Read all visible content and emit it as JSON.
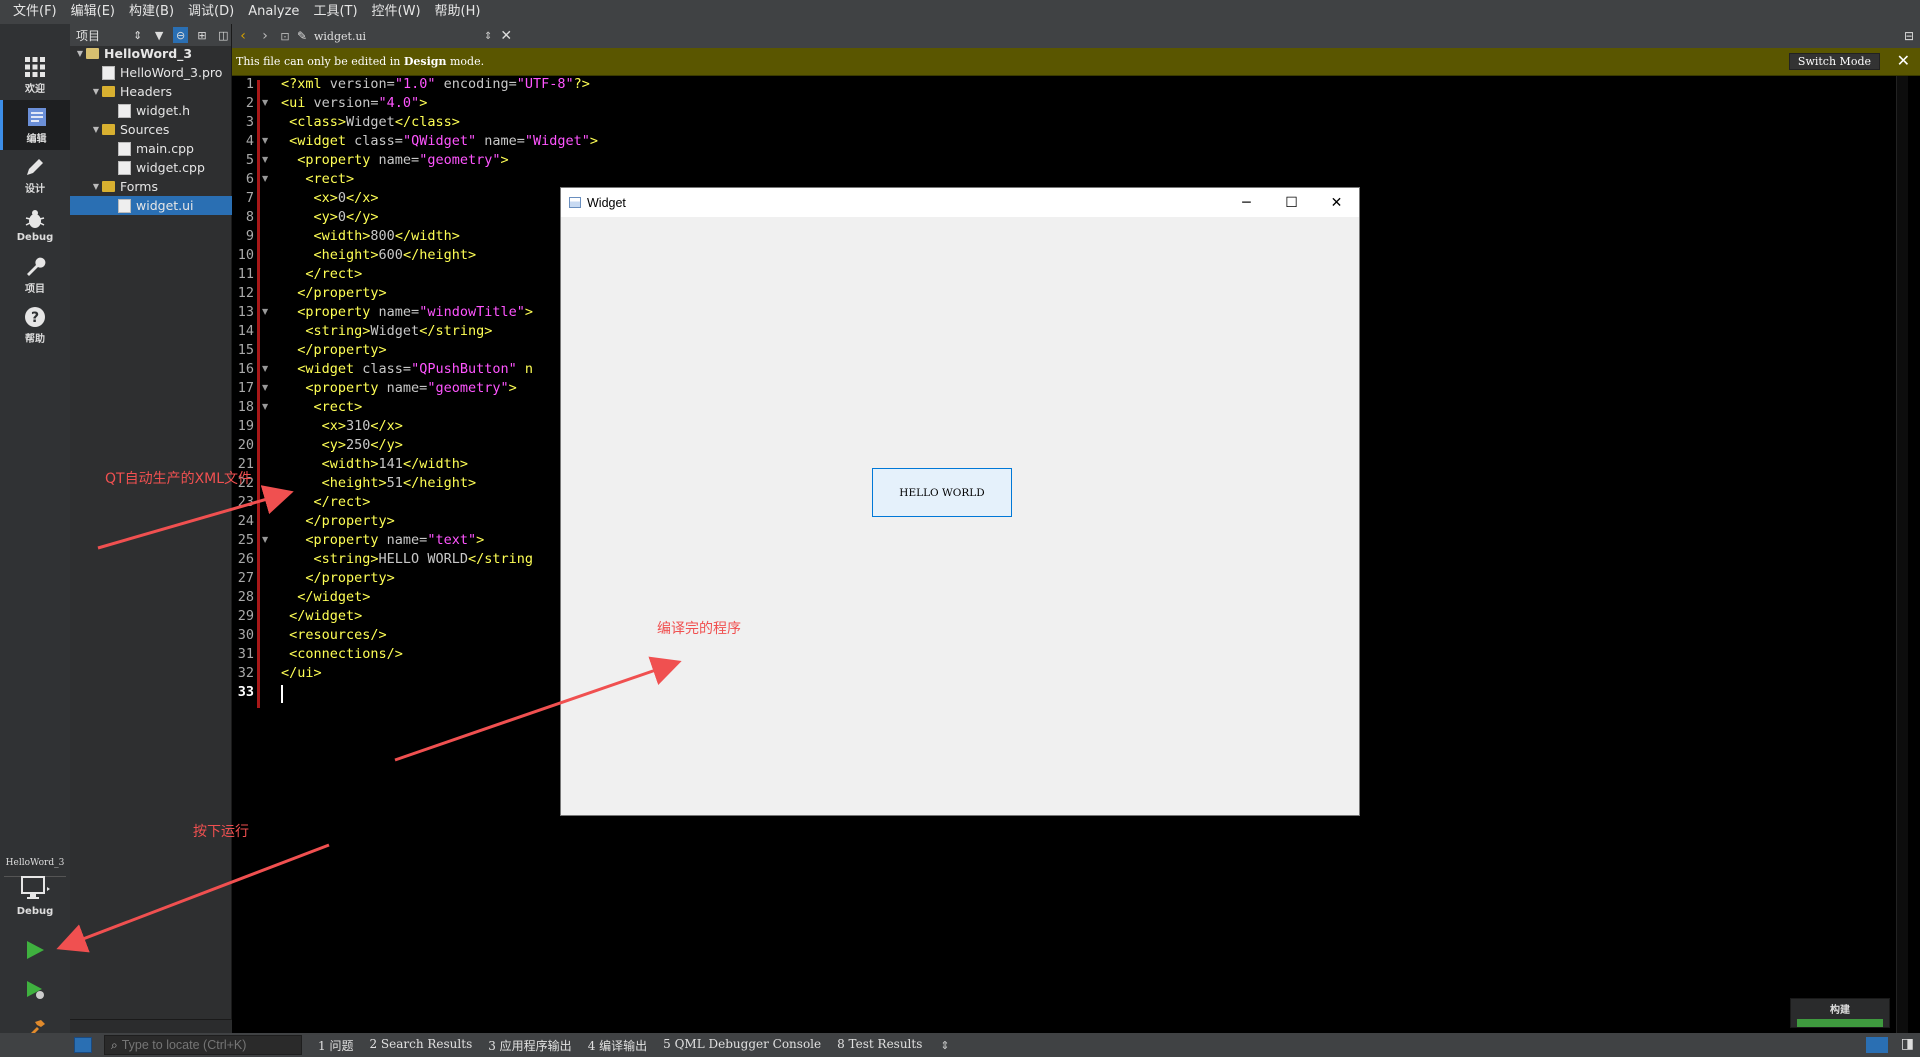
{
  "menu": [
    "文件(F)",
    "编辑(E)",
    "构建(B)",
    "调试(D)",
    "Analyze",
    "工具(T)",
    "控件(W)",
    "帮助(H)"
  ],
  "modes": [
    {
      "label": "欢迎",
      "icon": "grid-icon"
    },
    {
      "label": "编辑",
      "icon": "edit-doc-icon"
    },
    {
      "label": "设计",
      "icon": "pen-icon"
    },
    {
      "label": "Debug",
      "icon": "bug-icon"
    },
    {
      "label": "项目",
      "icon": "wrench-icon"
    },
    {
      "label": "帮助",
      "icon": "help-icon"
    }
  ],
  "project_panel": {
    "title": "项目",
    "tree": [
      {
        "label": "HelloWord_3",
        "level": 0,
        "expanded": true,
        "type": "project"
      },
      {
        "label": "HelloWord_3.pro",
        "level": 1,
        "type": "pro"
      },
      {
        "label": "Headers",
        "level": 1,
        "expanded": true,
        "type": "folder"
      },
      {
        "label": "widget.h",
        "level": 2,
        "type": "header"
      },
      {
        "label": "Sources",
        "level": 1,
        "expanded": true,
        "type": "folder"
      },
      {
        "label": "main.cpp",
        "level": 2,
        "type": "cpp"
      },
      {
        "label": "widget.cpp",
        "level": 2,
        "type": "cpp"
      },
      {
        "label": "Forms",
        "level": 1,
        "expanded": true,
        "type": "folder"
      },
      {
        "label": "widget.ui",
        "level": 2,
        "type": "ui",
        "selected": true
      }
    ]
  },
  "editor_toolbar": {
    "file_name": "widget.ui"
  },
  "infobar": {
    "message_pre": "This file can only be edited in ",
    "message_bold": "Design",
    "message_post": " mode.",
    "switch_label": "Switch Mode"
  },
  "code_lines": [
    "<?xml version=\"1.0\" encoding=\"UTF-8\"?>",
    "<ui version=\"4.0\">",
    " <class>Widget</class>",
    " <widget class=\"QWidget\" name=\"Widget\">",
    "  <property name=\"geometry\">",
    "   <rect>",
    "    <x>0</x>",
    "    <y>0</y>",
    "    <width>800</width>",
    "    <height>600</height>",
    "   </rect>",
    "  </property>",
    "  <property name=\"windowTitle\">",
    "   <string>Widget</string>",
    "  </property>",
    "  <widget class=\"QPushButton\" n",
    "   <property name=\"geometry\">",
    "    <rect>",
    "     <x>310</x>",
    "     <y>250</y>",
    "     <width>141</width>",
    "     <height>51</height>",
    "    </rect>",
    "   </property>",
    "   <property name=\"text\">",
    "    <string>HELLO WORLD</string",
    "   </property>",
    "  </widget>",
    " </widget>",
    " <resources/>",
    " <connections/>",
    "</ui>",
    ""
  ],
  "fold_lines": [
    2,
    4,
    5,
    6,
    13,
    16,
    17,
    18,
    25
  ],
  "current_line": 33,
  "app_window": {
    "title": "Widget",
    "button_text": "HELLO WORLD"
  },
  "annotations": {
    "xml": "QT自动生产的XML文件",
    "program": "编译完的程序",
    "run": "按下运行"
  },
  "run_target": {
    "project": "HelloWord_3",
    "mode": "Debug"
  },
  "locator": {
    "placeholder": "Type to locate (Ctrl+K)"
  },
  "output_tabs": [
    "1 问题",
    "2 Search Results",
    "3 应用程序输出",
    "4 编译输出",
    "5 QML Debugger Console",
    "8 Test Results"
  ],
  "build": {
    "label": "构建",
    "progress": 1.0
  },
  "colors": {
    "annotation": "#f05050",
    "tag": "#ffff55",
    "attr_value": "#ff55ff"
  }
}
